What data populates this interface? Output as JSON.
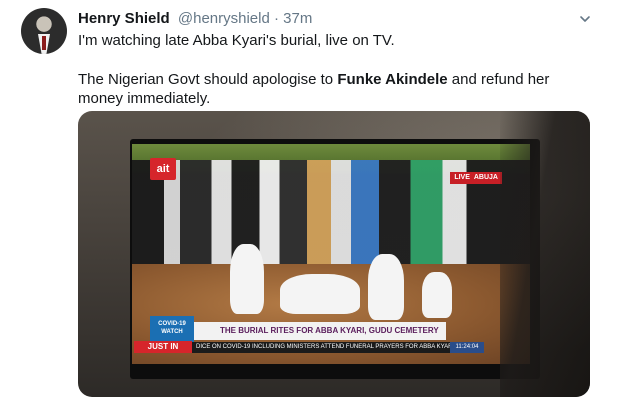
{
  "tweet": {
    "author_name": "Henry Shield",
    "author_handle": "@henryshield",
    "separator": "·",
    "time": "37m",
    "line1": "I'm watching late Abba Kyari's burial, live on TV.",
    "line2_before": "The Nigerian Govt should apologise to ",
    "line2_bold": "Funke Akindele",
    "line2_after": " and refund her money immediately."
  },
  "media": {
    "channel_logo": "ait",
    "live_label": "LIVE",
    "live_location": "ABUJA",
    "badge_line1": "COVID-19",
    "badge_line2": "WATCH",
    "headline": "THE BURIAL RITES FOR ABBA KYARI, GUDU CEMETERY",
    "just_in": "JUST IN",
    "ticker": "DICE ON COVID-19 INCLUDING MINISTERS ATTEND FUNERAL PRAYERS FOR ABBA KYARI AT",
    "clock": "11:24:04"
  },
  "icons": {
    "more": "chevron-down-icon"
  }
}
